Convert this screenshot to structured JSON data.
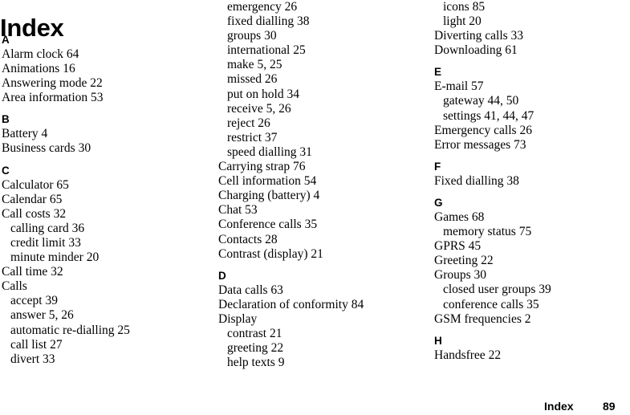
{
  "document": {
    "title": "Index",
    "footer": {
      "label": "Index",
      "page_number": "89"
    }
  },
  "columns": [
    {
      "id": "col-1",
      "blocks": [
        {
          "type": "letter",
          "text": "A"
        },
        {
          "type": "entry",
          "level": 0,
          "text": "Alarm clock 64"
        },
        {
          "type": "entry",
          "level": 0,
          "text": "Animations 16"
        },
        {
          "type": "entry",
          "level": 0,
          "text": "Answering mode 22"
        },
        {
          "type": "entry",
          "level": 0,
          "text": "Area information 53"
        },
        {
          "type": "letter",
          "text": "B"
        },
        {
          "type": "entry",
          "level": 0,
          "text": "Battery 4"
        },
        {
          "type": "entry",
          "level": 0,
          "text": "Business cards 30"
        },
        {
          "type": "letter",
          "text": "C"
        },
        {
          "type": "entry",
          "level": 0,
          "text": "Calculator 65"
        },
        {
          "type": "entry",
          "level": 0,
          "text": "Calendar 65"
        },
        {
          "type": "entry",
          "level": 0,
          "text": "Call costs 32"
        },
        {
          "type": "entry",
          "level": 1,
          "text": "calling card 36"
        },
        {
          "type": "entry",
          "level": 1,
          "text": "credit limit 33"
        },
        {
          "type": "entry",
          "level": 1,
          "text": "minute minder 20"
        },
        {
          "type": "entry",
          "level": 0,
          "text": "Call time 32"
        },
        {
          "type": "entry",
          "level": 0,
          "text": "Calls"
        },
        {
          "type": "entry",
          "level": 1,
          "text": "accept 39"
        },
        {
          "type": "entry",
          "level": 1,
          "text": "answer 5, 26"
        },
        {
          "type": "entry",
          "level": 1,
          "text": "automatic re-dialling 25"
        },
        {
          "type": "entry",
          "level": 1,
          "text": "call list 27"
        },
        {
          "type": "entry",
          "level": 1,
          "text": "divert 33"
        }
      ]
    },
    {
      "id": "col-2",
      "blocks": [
        {
          "type": "entry",
          "level": 1,
          "text": "emergency 26"
        },
        {
          "type": "entry",
          "level": 1,
          "text": "fixed dialling 38"
        },
        {
          "type": "entry",
          "level": 1,
          "text": "groups 30"
        },
        {
          "type": "entry",
          "level": 1,
          "text": "international 25"
        },
        {
          "type": "entry",
          "level": 1,
          "text": "make 5, 25"
        },
        {
          "type": "entry",
          "level": 1,
          "text": "missed 26"
        },
        {
          "type": "entry",
          "level": 1,
          "text": "put on hold 34"
        },
        {
          "type": "entry",
          "level": 1,
          "text": "receive 5, 26"
        },
        {
          "type": "entry",
          "level": 1,
          "text": "reject 26"
        },
        {
          "type": "entry",
          "level": 1,
          "text": "restrict 37"
        },
        {
          "type": "entry",
          "level": 1,
          "text": "speed dialling 31"
        },
        {
          "type": "entry",
          "level": 0,
          "text": "Carrying strap 76"
        },
        {
          "type": "entry",
          "level": 0,
          "text": "Cell information 54"
        },
        {
          "type": "entry",
          "level": 0,
          "text": "Charging (battery) 4"
        },
        {
          "type": "entry",
          "level": 0,
          "text": "Chat 53"
        },
        {
          "type": "entry",
          "level": 0,
          "text": "Conference calls 35"
        },
        {
          "type": "entry",
          "level": 0,
          "text": "Contacts 28"
        },
        {
          "type": "entry",
          "level": 0,
          "text": "Contrast (display) 21"
        },
        {
          "type": "letter",
          "text": "D"
        },
        {
          "type": "entry",
          "level": 0,
          "text": "Data calls 63"
        },
        {
          "type": "entry",
          "level": 0,
          "text": "Declaration of conformity 84"
        },
        {
          "type": "entry",
          "level": 0,
          "text": "Display"
        },
        {
          "type": "entry",
          "level": 1,
          "text": "contrast 21"
        },
        {
          "type": "entry",
          "level": 1,
          "text": "greeting 22"
        },
        {
          "type": "entry",
          "level": 1,
          "text": "help texts 9"
        }
      ]
    },
    {
      "id": "col-3",
      "blocks": [
        {
          "type": "entry",
          "level": 1,
          "text": "icons 85"
        },
        {
          "type": "entry",
          "level": 1,
          "text": "light 20"
        },
        {
          "type": "entry",
          "level": 0,
          "text": "Diverting calls 33"
        },
        {
          "type": "entry",
          "level": 0,
          "text": "Downloading 61"
        },
        {
          "type": "letter",
          "text": "E"
        },
        {
          "type": "entry",
          "level": 0,
          "text": "E-mail 57"
        },
        {
          "type": "entry",
          "level": 1,
          "text": "gateway 44, 50"
        },
        {
          "type": "entry",
          "level": 1,
          "text": "settings 41, 44, 47"
        },
        {
          "type": "entry",
          "level": 0,
          "text": "Emergency calls 26"
        },
        {
          "type": "entry",
          "level": 0,
          "text": "Error messages 73"
        },
        {
          "type": "letter",
          "text": "F"
        },
        {
          "type": "entry",
          "level": 0,
          "text": "Fixed dialling 38"
        },
        {
          "type": "letter",
          "text": "G"
        },
        {
          "type": "entry",
          "level": 0,
          "text": "Games 68"
        },
        {
          "type": "entry",
          "level": 1,
          "text": "memory status 75"
        },
        {
          "type": "entry",
          "level": 0,
          "text": "GPRS 45"
        },
        {
          "type": "entry",
          "level": 0,
          "text": "Greeting 22"
        },
        {
          "type": "entry",
          "level": 0,
          "text": "Groups 30"
        },
        {
          "type": "entry",
          "level": 1,
          "text": "closed user groups 39"
        },
        {
          "type": "entry",
          "level": 1,
          "text": "conference calls 35"
        },
        {
          "type": "entry",
          "level": 0,
          "text": "GSM frequencies 2"
        },
        {
          "type": "letter",
          "text": "H"
        },
        {
          "type": "entry",
          "level": 0,
          "text": "Handsfree 22"
        }
      ]
    }
  ]
}
